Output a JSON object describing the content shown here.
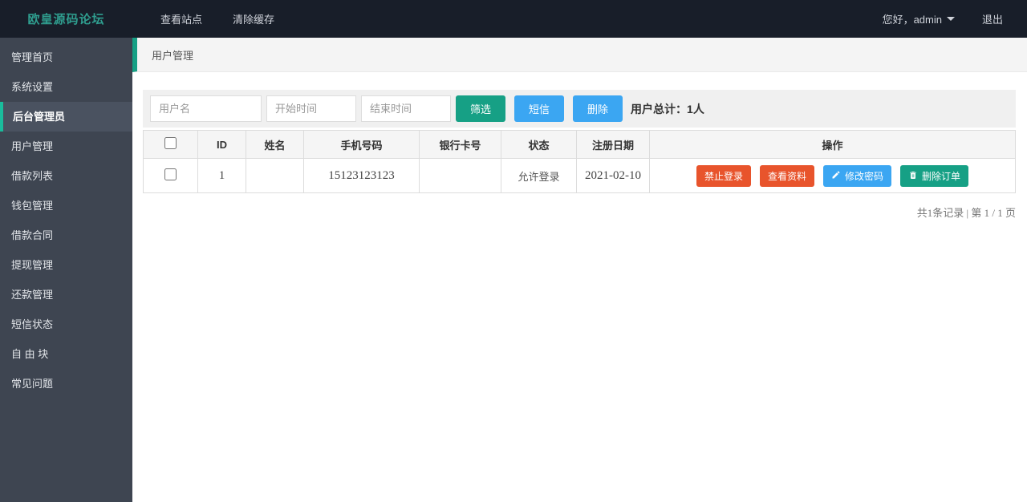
{
  "topbar": {
    "logo": "欧皇源码论坛",
    "nav_items": [
      {
        "label": "查看站点"
      },
      {
        "label": "清除缓存"
      }
    ],
    "greeting": "您好，admin",
    "logout": "退出"
  },
  "sidebar": {
    "items": [
      {
        "label": "管理首页",
        "active": false
      },
      {
        "label": "系统设置",
        "active": false
      },
      {
        "label": "后台管理员",
        "active": true
      },
      {
        "label": "用户管理",
        "active": false
      },
      {
        "label": "借款列表",
        "active": false
      },
      {
        "label": "钱包管理",
        "active": false
      },
      {
        "label": "借款合同",
        "active": false
      },
      {
        "label": "提现管理",
        "active": false
      },
      {
        "label": "还款管理",
        "active": false
      },
      {
        "label": "短信状态",
        "active": false
      },
      {
        "label": "自 由 块",
        "active": false
      },
      {
        "label": "常见问题",
        "active": false
      }
    ]
  },
  "breadcrumb": {
    "title": "用户管理"
  },
  "filters": {
    "username_placeholder": "用户名",
    "start_placeholder": "开始时间",
    "end_placeholder": "结束时间",
    "filter_button": "筛选",
    "sms_button": "短信",
    "delete_button": "删除",
    "total_label": "用户总计：1人"
  },
  "table": {
    "headers": [
      "ID",
      "姓名",
      "手机号码",
      "银行卡号",
      "状态",
      "注册日期",
      "操作"
    ],
    "rows": [
      {
        "id": "1",
        "name": "",
        "phone": "15123123123",
        "bank_card": "",
        "status": "允许登录",
        "reg_date": "2021-02-10",
        "actions": [
          {
            "label": "禁止登录"
          },
          {
            "label": "查看资料"
          },
          {
            "label": "修改密码"
          },
          {
            "label": "删除订单"
          }
        ]
      }
    ]
  },
  "pagination": {
    "summary": "共1条记录 | 第 1 / 1 页"
  },
  "colors": {
    "accent_teal": "#16a085",
    "accent_blue": "#3ba6f2",
    "accent_orange": "#e8542c",
    "topbar_bg": "#181e29",
    "sidebar_bg": "#3e4551",
    "sidebar_active_bg": "#4a5260",
    "logo_color": "#2f9e8f"
  }
}
